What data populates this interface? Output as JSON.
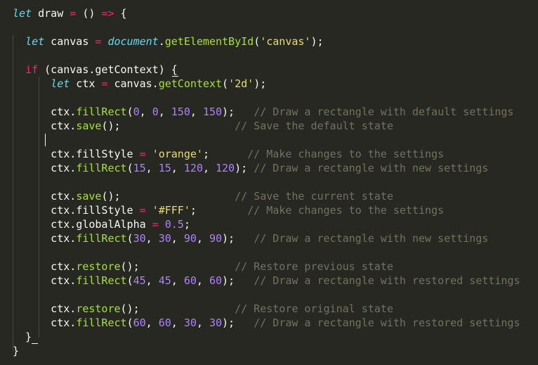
{
  "editor": {
    "lines": [
      [
        [
          "kw",
          "let"
        ],
        [
          "var",
          " draw "
        ],
        [
          "op",
          "="
        ],
        [
          "var",
          " () "
        ],
        [
          "op",
          "=>"
        ],
        [
          "var",
          " {"
        ]
      ],
      [],
      [
        [
          "var",
          "  "
        ],
        [
          "kw",
          "let"
        ],
        [
          "var",
          " canvas "
        ],
        [
          "op",
          "="
        ],
        [
          "var",
          " "
        ],
        [
          "obj",
          "document"
        ],
        [
          "var",
          "."
        ],
        [
          "fn",
          "getElementById"
        ],
        [
          "var",
          "("
        ],
        [
          "str",
          "'canvas'"
        ],
        [
          "var",
          ");"
        ]
      ],
      [],
      [
        [
          "var",
          "  "
        ],
        [
          "ctl",
          "if"
        ],
        [
          "var",
          " (canvas.getContext) {"
        ]
      ],
      [
        [
          "var",
          "      "
        ],
        [
          "kw",
          "let"
        ],
        [
          "var",
          " ctx "
        ],
        [
          "op",
          "="
        ],
        [
          "var",
          " canvas."
        ],
        [
          "fn",
          "getContext"
        ],
        [
          "var",
          "("
        ],
        [
          "str",
          "'2d'"
        ],
        [
          "var",
          ");"
        ]
      ],
      [],
      [
        [
          "var",
          "      ctx."
        ],
        [
          "fn",
          "fillRect"
        ],
        [
          "var",
          "("
        ],
        [
          "num",
          "0"
        ],
        [
          "var",
          ", "
        ],
        [
          "num",
          "0"
        ],
        [
          "var",
          ", "
        ],
        [
          "num",
          "150"
        ],
        [
          "var",
          ", "
        ],
        [
          "num",
          "150"
        ],
        [
          "var",
          ");   "
        ],
        [
          "cmt",
          "// Draw a rectangle with default settings"
        ]
      ],
      [
        [
          "var",
          "      ctx."
        ],
        [
          "fn",
          "save"
        ],
        [
          "var",
          "();                  "
        ],
        [
          "cmt",
          "// Save the default state"
        ]
      ],
      [],
      [
        [
          "var",
          "      ctx.fillStyle "
        ],
        [
          "op",
          "="
        ],
        [
          "var",
          " "
        ],
        [
          "str",
          "'orange'"
        ],
        [
          "var",
          ";      "
        ],
        [
          "cmt",
          "// Make changes to the settings"
        ]
      ],
      [
        [
          "var",
          "      ctx."
        ],
        [
          "fn",
          "fillRect"
        ],
        [
          "var",
          "("
        ],
        [
          "num",
          "15"
        ],
        [
          "var",
          ", "
        ],
        [
          "num",
          "15"
        ],
        [
          "var",
          ", "
        ],
        [
          "num",
          "120"
        ],
        [
          "var",
          ", "
        ],
        [
          "num",
          "120"
        ],
        [
          "var",
          "); "
        ],
        [
          "cmt",
          "// Draw a rectangle with new settings"
        ]
      ],
      [],
      [
        [
          "var",
          "      ctx."
        ],
        [
          "fn",
          "save"
        ],
        [
          "var",
          "();                  "
        ],
        [
          "cmt",
          "// Save the current state"
        ]
      ],
      [
        [
          "var",
          "      ctx.fillStyle "
        ],
        [
          "op",
          "="
        ],
        [
          "var",
          " "
        ],
        [
          "str",
          "'#FFF'"
        ],
        [
          "var",
          ";        "
        ],
        [
          "cmt",
          "// Make changes to the settings"
        ]
      ],
      [
        [
          "var",
          "      ctx.globalAlpha "
        ],
        [
          "op",
          "="
        ],
        [
          "var",
          " "
        ],
        [
          "num",
          "0.5"
        ],
        [
          "var",
          ";"
        ]
      ],
      [
        [
          "var",
          "      ctx."
        ],
        [
          "fn",
          "fillRect"
        ],
        [
          "var",
          "("
        ],
        [
          "num",
          "30"
        ],
        [
          "var",
          ", "
        ],
        [
          "num",
          "30"
        ],
        [
          "var",
          ", "
        ],
        [
          "num",
          "90"
        ],
        [
          "var",
          ", "
        ],
        [
          "num",
          "90"
        ],
        [
          "var",
          ");   "
        ],
        [
          "cmt",
          "// Draw a rectangle with new settings"
        ]
      ],
      [],
      [
        [
          "var",
          "      ctx."
        ],
        [
          "fn",
          "restore"
        ],
        [
          "var",
          "();               "
        ],
        [
          "cmt",
          "// Restore previous state"
        ]
      ],
      [
        [
          "var",
          "      ctx."
        ],
        [
          "fn",
          "fillRect"
        ],
        [
          "var",
          "("
        ],
        [
          "num",
          "45"
        ],
        [
          "var",
          ", "
        ],
        [
          "num",
          "45"
        ],
        [
          "var",
          ", "
        ],
        [
          "num",
          "60"
        ],
        [
          "var",
          ", "
        ],
        [
          "num",
          "60"
        ],
        [
          "var",
          ");   "
        ],
        [
          "cmt",
          "// Draw a rectangle with restored settings"
        ]
      ],
      [],
      [
        [
          "var",
          "      ctx."
        ],
        [
          "fn",
          "restore"
        ],
        [
          "var",
          "();               "
        ],
        [
          "cmt",
          "// Restore original state"
        ]
      ],
      [
        [
          "var",
          "      ctx."
        ],
        [
          "fn",
          "fillRect"
        ],
        [
          "var",
          "("
        ],
        [
          "num",
          "60"
        ],
        [
          "var",
          ", "
        ],
        [
          "num",
          "60"
        ],
        [
          "var",
          ", "
        ],
        [
          "num",
          "30"
        ],
        [
          "var",
          ", "
        ],
        [
          "num",
          "30"
        ],
        [
          "var",
          ");   "
        ],
        [
          "cmt",
          "// Draw a rectangle with restored settings"
        ]
      ],
      [
        [
          "var",
          "  }"
        ]
      ],
      [
        [
          "var",
          "}"
        ]
      ]
    ]
  },
  "colors": {
    "background": "#272822",
    "keyword": "#66d9ef",
    "operator": "#f92672",
    "function": "#a6e22e",
    "number": "#ae81ff",
    "string": "#e6db74",
    "comment": "#75715e",
    "text": "#f8f8f2"
  }
}
